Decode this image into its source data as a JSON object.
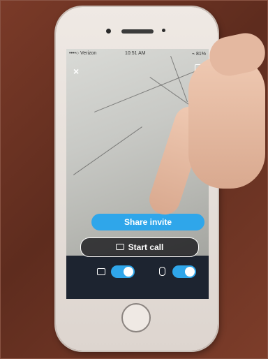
{
  "status_bar": {
    "carrier": "••••○ Verizon",
    "time": "10:51 AM",
    "battery": "⌁ 81%"
  },
  "screen": {
    "close_label": "×",
    "share_invite_label": "Share invite",
    "start_call_label": "Start call"
  },
  "icons": [
    "close-icon",
    "rotate-camera-icon",
    "video-camera-icon",
    "microphone-icon"
  ],
  "colors": {
    "accent": "#2fa6ea",
    "phone_body": "#ece6e0",
    "background": "#6b3424"
  },
  "toggles": {
    "video_on": true,
    "mic_on": true
  }
}
